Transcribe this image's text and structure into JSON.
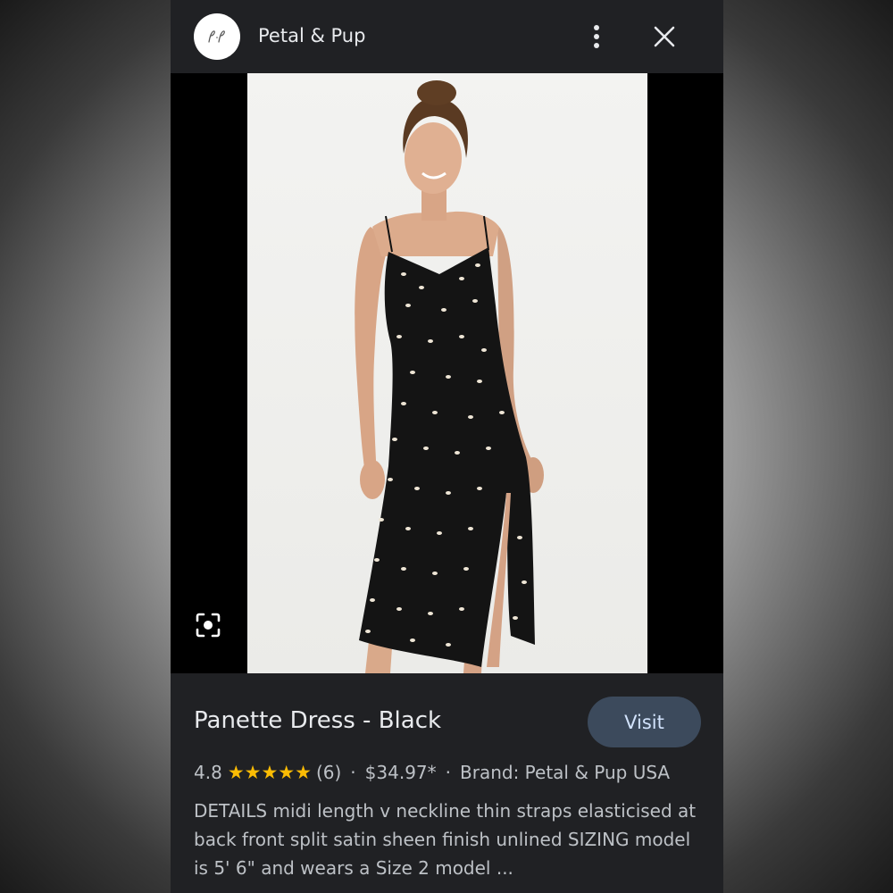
{
  "header": {
    "site_name": "Petal & Pup",
    "logo_icon": "petal-pup-logo",
    "more_icon": "more-vertical-icon",
    "close_icon": "close-icon"
  },
  "image": {
    "subject": "dress-photo",
    "lens_icon": "google-lens-icon"
  },
  "product": {
    "title": "Panette Dress - Black",
    "visit_label": "Visit",
    "rating": "4.8",
    "stars": "★★★★★",
    "review_count": "(6)",
    "separator": "·",
    "price": "$34.97*",
    "brand": "Brand: Petal & Pup USA",
    "description": "DETAILS midi length v neckline thin straps elasticised at back front split satin sheen finish unlined SIZING model is 5' 6\" and wears a Size 2 model ..."
  },
  "colors": {
    "panel_bg": "#202124",
    "star": "#fbbc04",
    "visit_bg": "#3c4a5c",
    "visit_text": "#d2e3fc"
  }
}
